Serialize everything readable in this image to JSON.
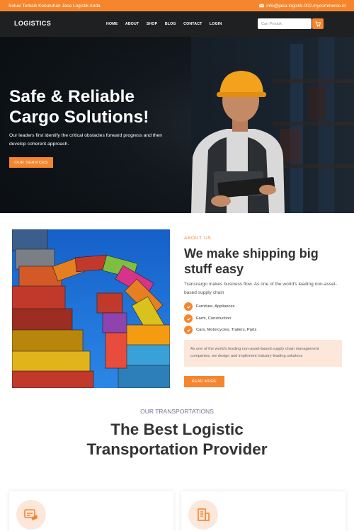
{
  "topbar": {
    "tagline": "Solusi Terbaik Kebutuhan Jasa Logistik Anda",
    "email": "info@jasa-logistik-002.mycommerce.id"
  },
  "nav": {
    "logo": "LOGISTICS",
    "items": [
      "HOME",
      "ABOUT",
      "SHOP",
      "BLOG",
      "CONTACT",
      "LOGIN"
    ],
    "search_placeholder": "Cari Produk"
  },
  "hero": {
    "title_line1": "Safe & Reliable",
    "title_line2": "Cargo Solutions!",
    "subtitle": "Our leaders first identify the critical obstacles forward progress and then develop coherent approach.",
    "button": "OUR SERVICES"
  },
  "about": {
    "label": "ABOUT US",
    "title": "We make shipping big stuff easy",
    "text": "Transcargo makes business flow. As one of the world's leading non-asset-based supply chain",
    "features": [
      "Furniture, Appliances",
      "Farm, Construction",
      "Cars, Motorcycles, Trailers, Parts"
    ],
    "box_text": "As one of the world's leading non-asset-based supply chain management companies, we design and implement industry-leading solutions",
    "button": "READ MORE"
  },
  "transport": {
    "label": "OUR TRANSPORTATIONS",
    "title": "The Best Logistic Transportation Provider"
  },
  "colors": {
    "accent": "#f5862e",
    "nav_bg": "#1f2021",
    "accent_light": "#fde6da"
  },
  "icons": [
    "mail-icon",
    "cart-icon",
    "check-icon",
    "truck-icon",
    "building-icon"
  ]
}
